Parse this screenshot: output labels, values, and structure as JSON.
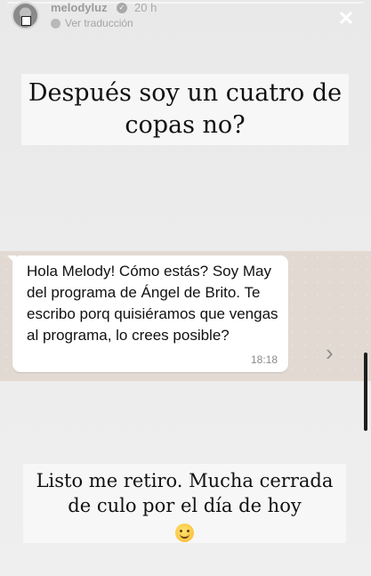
{
  "header": {
    "username": "melodyluz",
    "time_ago": "20 h",
    "translate_label": "Ver traducción",
    "icons": {
      "verified": "verified-badge-icon",
      "close": "close-icon"
    }
  },
  "captions": {
    "top": "Después soy un cuatro de copas no?",
    "bottom": "Listo me retiro. Mucha cerrada de culo por el día de hoy"
  },
  "chat": {
    "message": "Hola Melody! Cómo estás? Soy May del programa de Ángel de Brito. Te escribo porq quisiéramos que vengas al programa, lo crees posible?",
    "timestamp": "18:18"
  },
  "colors": {
    "background": "#ececec",
    "chat_background": "#e2dad2",
    "bubble": "#ffffff"
  }
}
